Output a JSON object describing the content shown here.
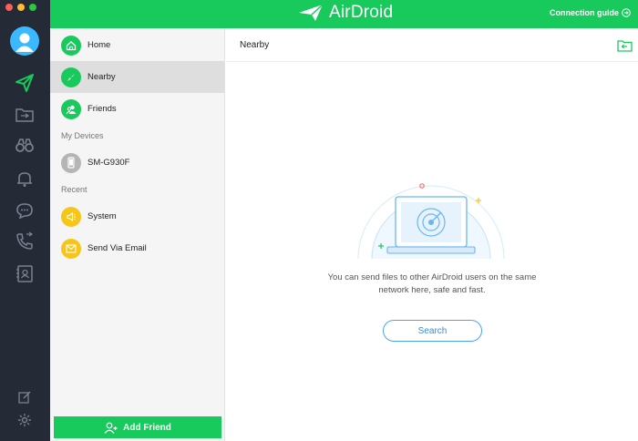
{
  "window": {
    "traffic_colors": [
      "#fd5f57",
      "#febc2e",
      "#28c840"
    ]
  },
  "topbar": {
    "brand": "AirDroid",
    "connection_guide": "Connection guide",
    "bg_color": "#18c95c"
  },
  "rail": {
    "icons": [
      "paper-plane-icon",
      "folder-transfer-icon",
      "binoculars-icon",
      "bell-icon",
      "chat-bubble-icon",
      "phone-icon",
      "contacts-icon",
      "edit-icon",
      "gear-icon"
    ],
    "active_icon": "paper-plane-icon"
  },
  "sidebar": {
    "items": [
      {
        "label": "Home",
        "icon": "home-icon",
        "color": "#18c95c"
      },
      {
        "label": "Nearby",
        "icon": "compass-icon",
        "color": "#18c95c"
      },
      {
        "label": "Friends",
        "icon": "friends-icon",
        "color": "#18c95c"
      }
    ],
    "my_devices_label": "My Devices",
    "devices": [
      {
        "label": "SM-G930F",
        "icon": "phone-device-icon",
        "color": "#b5b5b5"
      }
    ],
    "recent_label": "Recent",
    "recent": [
      {
        "label": "System",
        "icon": "megaphone-icon",
        "color": "#f5c518"
      },
      {
        "label": "Send Via Email",
        "icon": "envelope-icon",
        "color": "#f5c518"
      }
    ],
    "add_friend": "Add Friend"
  },
  "main": {
    "title": "Nearby",
    "description": "You can send files to other AirDroid users on the same network here, safe and fast.",
    "search_button": "Search"
  }
}
